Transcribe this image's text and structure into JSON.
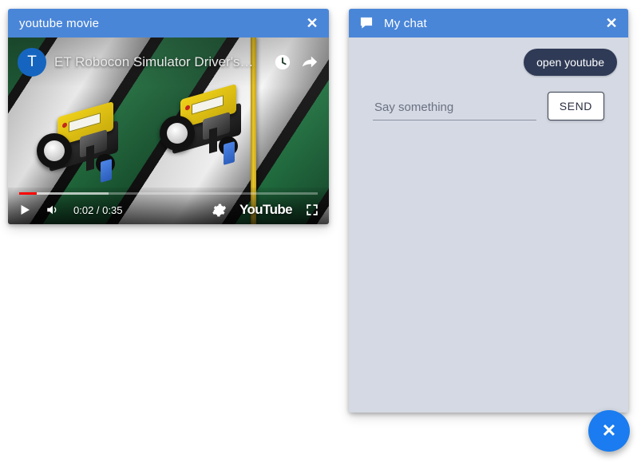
{
  "page": {
    "background_color": "#ffffff",
    "accent_color": "#4a86d8",
    "chat_background_color": "#d4d9e3",
    "bubble_color": "#2f3a56",
    "fab_color": "#1a7cf0"
  },
  "youtube_window": {
    "title": "youtube movie",
    "close_label": "✕",
    "close_icon": "close-icon",
    "video": {
      "channel_avatar_initial": "T",
      "title": "ET Robocon Simulator Driver's…",
      "watch_later_icon": "clock-icon",
      "share_icon": "share-arrow-icon",
      "play_icon": "play-icon",
      "volume_icon": "volume-icon",
      "settings_icon": "gear-icon",
      "fullscreen_icon": "fullscreen-icon",
      "brand_label": "YouTube",
      "current_time": "0:02",
      "duration": "0:35",
      "time_display": "0:02 / 0:35",
      "progress_percent": 6,
      "buffered_percent": 30
    }
  },
  "chat_window": {
    "icon": "chat-bubble-icon",
    "title": "My chat",
    "close_label": "✕",
    "close_icon": "close-icon",
    "messages": [
      {
        "text": "open youtube",
        "direction": "outgoing"
      }
    ],
    "composer": {
      "input_value": "",
      "placeholder": "Say something",
      "send_label": "SEND"
    }
  },
  "fab": {
    "glyph": "✕",
    "icon": "close-icon",
    "label": "close"
  }
}
